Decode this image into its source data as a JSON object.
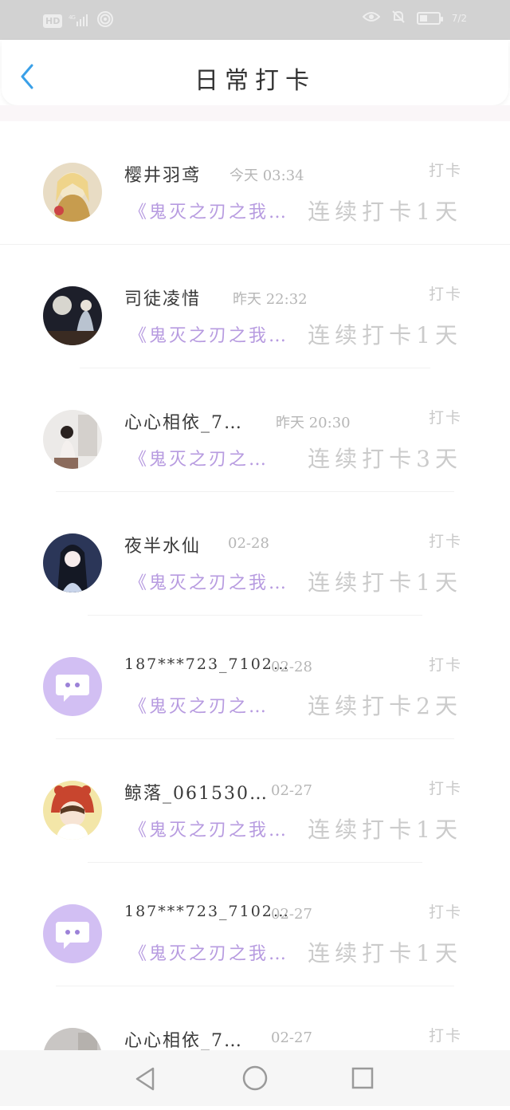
{
  "status": {
    "network": "4G",
    "hd": "HD",
    "battery_text": "7/2"
  },
  "header": {
    "title": "日常打卡"
  },
  "accent": "#3aa0e8",
  "group_color": "#b79be0",
  "items": [
    {
      "name": "樱井羽鸢",
      "time": "今天 03:34",
      "action": "打卡",
      "group": "《鬼灭之刃之我…",
      "streak": "连续打卡1天",
      "avatar": "anime-girl-blonde"
    },
    {
      "name": "司徒凌惜",
      "time": "昨天 22:32",
      "action": "打卡",
      "group": "《鬼灭之刃之我…",
      "streak": "连续打卡1天",
      "avatar": "moon-night"
    },
    {
      "name": "心心相依_7…",
      "time": "昨天 20:30",
      "action": "打卡",
      "group": "《鬼灭之刃之…",
      "streak": "连续打卡3天",
      "avatar": "photo-girl"
    },
    {
      "name": "夜半水仙",
      "time": "02-28",
      "action": "打卡",
      "group": "《鬼灭之刃之我…",
      "streak": "连续打卡1天",
      "avatar": "anime-dark-hair"
    },
    {
      "name": "187***723_7102…",
      "time": "02-28",
      "action": "打卡",
      "group": "《鬼灭之刃之…",
      "streak": "连续打卡2天",
      "avatar": "default-chat"
    },
    {
      "name": "鲸落_061530…",
      "time": "02-27",
      "action": "打卡",
      "group": "《鬼灭之刃之我…",
      "streak": "连续打卡1天",
      "avatar": "cartoon-hat"
    },
    {
      "name": "187***723_7102…",
      "time": "02-27",
      "action": "打卡",
      "group": "《鬼灭之刃之我…",
      "streak": "连续打卡1天",
      "avatar": "default-chat"
    },
    {
      "name": "心心相依_7…",
      "time": "02-27",
      "action": "打卡",
      "group": "",
      "streak": "",
      "avatar": "photo-girl"
    }
  ],
  "nav": {
    "back": "back-triangle",
    "home": "home-circle",
    "recents": "recents-square"
  }
}
